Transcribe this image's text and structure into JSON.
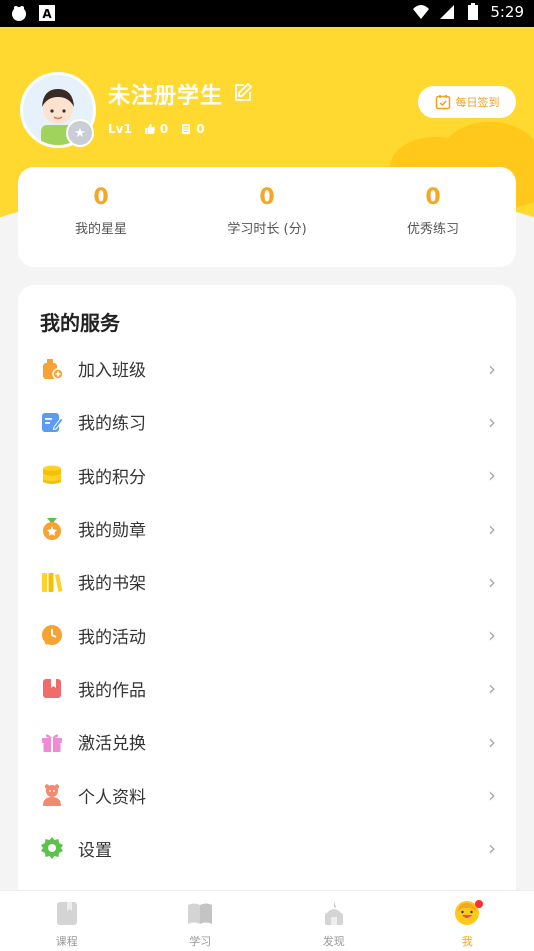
{
  "status_bar": {
    "time": "5:29"
  },
  "profile": {
    "name": "未注册学生",
    "level": "Lv1",
    "likes": "0",
    "records": "0",
    "checkin_label": "每日签到"
  },
  "stats": [
    {
      "value": "0",
      "label": "我的星星"
    },
    {
      "value": "0",
      "label": "学习时长 (分)"
    },
    {
      "value": "0",
      "label": "优秀练习"
    }
  ],
  "services": {
    "title": "我的服务",
    "items": [
      {
        "label": "加入班级",
        "icon": "join-class-icon",
        "color": "#f7a233"
      },
      {
        "label": "我的练习",
        "icon": "exercise-icon",
        "color": "#5b9cf2"
      },
      {
        "label": "我的积分",
        "icon": "points-icon",
        "color": "#ffd12a"
      },
      {
        "label": "我的勋章",
        "icon": "medal-icon",
        "color": "#f7a233"
      },
      {
        "label": "我的书架",
        "icon": "bookshelf-icon",
        "color": "#ffd12a"
      },
      {
        "label": "我的活动",
        "icon": "activity-icon",
        "color": "#f7a233"
      },
      {
        "label": "我的作品",
        "icon": "works-icon",
        "color": "#f26b6b"
      },
      {
        "label": "激活兑换",
        "icon": "gift-icon",
        "color": "#f08ad6"
      },
      {
        "label": "个人资料",
        "icon": "profile-icon",
        "color": "#f3896d"
      },
      {
        "label": "设置",
        "icon": "settings-icon",
        "color": "#5cc24b"
      }
    ]
  },
  "tabs": [
    {
      "label": "课程",
      "icon": "course-icon"
    },
    {
      "label": "学习",
      "icon": "book-icon"
    },
    {
      "label": "发现",
      "icon": "discover-icon"
    },
    {
      "label": "我",
      "icon": "me-icon"
    }
  ],
  "colors": {
    "header": "#ffd92f",
    "accent": "#f5a623"
  }
}
